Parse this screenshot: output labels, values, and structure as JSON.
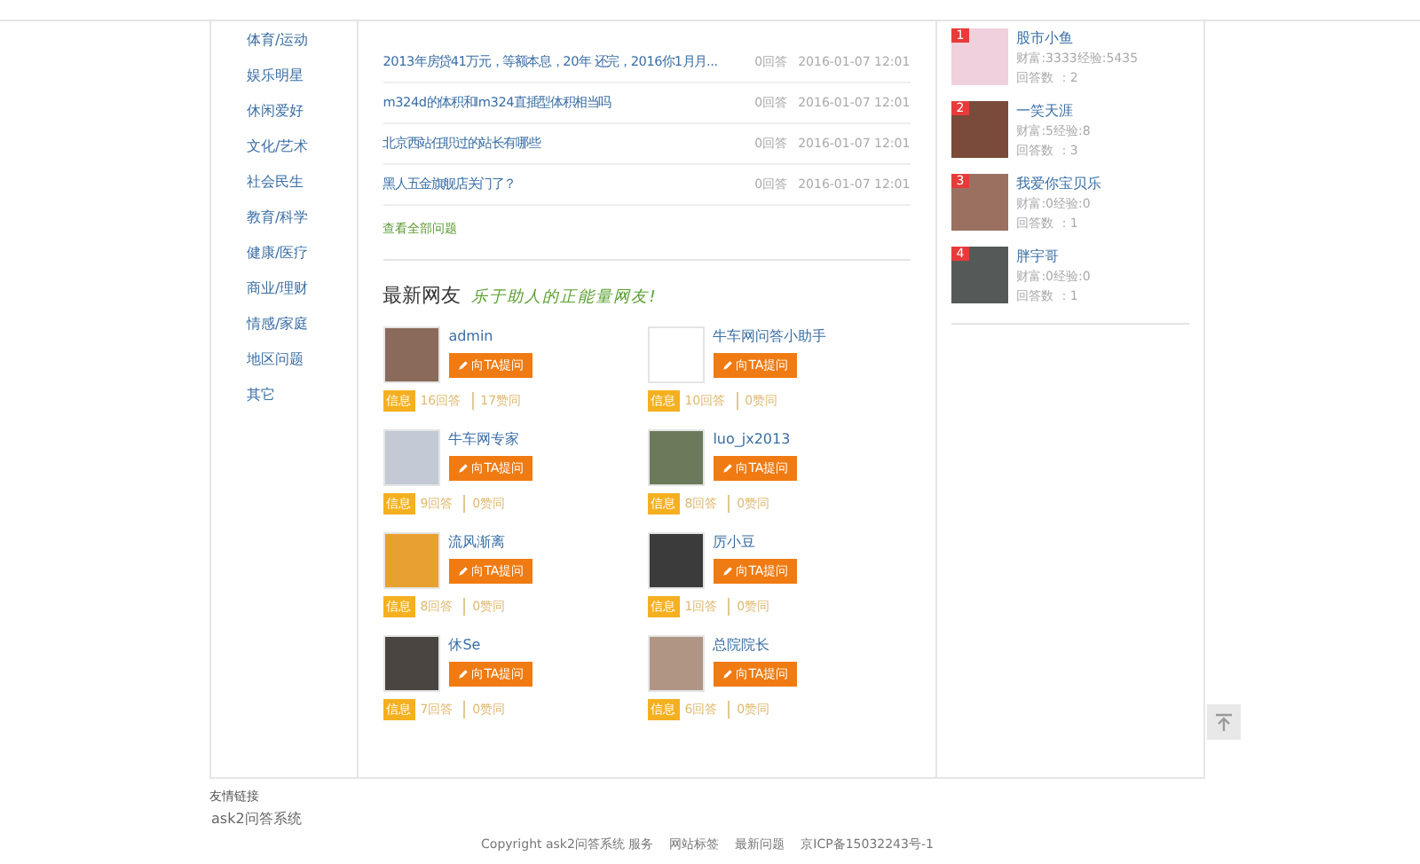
{
  "categories": [
    "体育/运动",
    "娱乐明星",
    "休闲爱好",
    "文化/艺术",
    "社会民生",
    "教育/科学",
    "健康/医疗",
    "商业/理财",
    "情感/家庭",
    "地区问题",
    "其它"
  ],
  "questions": [
    {
      "title": "2013年房贷41万元，等额本息，20年 还完，2016你1月月...",
      "answers": "0回答",
      "time": "2016-01-07 12:01"
    },
    {
      "title": "m324d的体积和lm324直插型体积相当吗",
      "answers": "0回答",
      "time": "2016-01-07 12:01"
    },
    {
      "title": "北京西站任职过的站长有哪些",
      "answers": "0回答",
      "time": "2016-01-07 12:01"
    },
    {
      "title": "黑人五金旗舰店关门了？",
      "answers": "0回答",
      "time": "2016-01-07 12:01"
    }
  ],
  "view_all": "查看全部问题",
  "new_users": {
    "title": "最新网友",
    "slogan": "乐于助人的正能量网友!",
    "users": [
      {
        "name": "admin",
        "button": "向TA提问",
        "badge": "信息",
        "answers": "16回答",
        "likes": "17赞同",
        "color": "#8a6a5a"
      },
      {
        "name": "牛车网问答小助手",
        "button": "向TA提问",
        "badge": "信息",
        "answers": "10回答",
        "likes": "0赞同",
        "color": "#ffffff"
      },
      {
        "name": "牛车网专家",
        "button": "向TA提问",
        "badge": "信息",
        "answers": "9回答",
        "likes": "0赞同",
        "color": "#c3cad6"
      },
      {
        "name": "luo_jx2013",
        "button": "向TA提问",
        "badge": "信息",
        "answers": "8回答",
        "likes": "0赞同",
        "color": "#6b7a5a"
      },
      {
        "name": "流风渐离",
        "button": "向TA提问",
        "badge": "信息",
        "answers": "8回答",
        "likes": "0赞同",
        "color": "#e8a030"
      },
      {
        "name": "厉小豆",
        "button": "向TA提问",
        "badge": "信息",
        "answers": "1回答",
        "likes": "0赞同",
        "color": "#3b3b3b"
      },
      {
        "name": "休Se",
        "button": "向TA提问",
        "badge": "信息",
        "answers": "7回答",
        "likes": "0赞同",
        "color": "#4a4540"
      },
      {
        "name": "总院院长",
        "button": "向TA提问",
        "badge": "信息",
        "answers": "6回答",
        "likes": "0赞同",
        "color": "#b09585"
      }
    ]
  },
  "ranking": [
    {
      "rank": "1",
      "name": "股市小鱼",
      "stats": "财富:3333经验:5435",
      "answers": "回答数 ：2",
      "color": "#f0d0dc"
    },
    {
      "rank": "2",
      "name": "一笑天涯",
      "stats": "财富:5经验:8",
      "answers": "回答数 ：3",
      "color": "#7a4a3a"
    },
    {
      "rank": "3",
      "name": "我爱你宝贝乐",
      "stats": "财富:0经验:0",
      "answers": "回答数 ：1",
      "color": "#9a7060"
    },
    {
      "rank": "4",
      "name": "胖宇哥",
      "stats": "财富:0经验:0",
      "answers": "回答数 ：1",
      "color": "#555a58"
    }
  ],
  "footer": {
    "links_title": "友情链接",
    "links": [
      "ask2问答系统"
    ],
    "items": [
      "Copyright ask2问答系统 服务",
      "网站标签",
      "最新问题",
      "京ICP备15032243号-1"
    ]
  }
}
